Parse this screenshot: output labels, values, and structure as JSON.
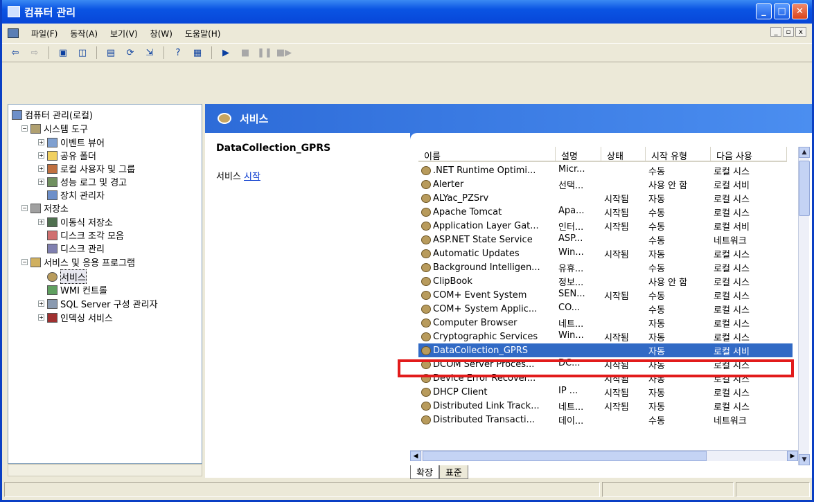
{
  "window": {
    "title": "컴퓨터 관리"
  },
  "menu": {
    "items": [
      "파일(F)",
      "동작(A)",
      "보기(V)",
      "창(W)",
      "도움말(H)"
    ]
  },
  "tree": {
    "root": "컴퓨터 관리(로컬)",
    "nodes": [
      "시스템 도구",
      "이벤트 뷰어",
      "공유 폴더",
      "로컬 사용자 및 그룹",
      "성능 로그 및 경고",
      "장치 관리자",
      "저장소",
      "이동식 저장소",
      "디스크 조각 모음",
      "디스크 관리",
      "서비스 및 응용 프로그램",
      "서비스",
      "WMI 컨트롤",
      "SQL Server 구성 관리자",
      "인덱싱 서비스"
    ]
  },
  "pane": {
    "title": "서비스",
    "selected_service": "DataCollection_GPRS",
    "action_prefix": "서비스",
    "action_link": "시작"
  },
  "list": {
    "headers": [
      "이름",
      "설명",
      "상태",
      "시작 유형",
      "다음 사용"
    ],
    "rows": [
      [
        ".NET Runtime Optimi...",
        "Micr...",
        "",
        "수동",
        "로컬 시스"
      ],
      [
        "Alerter",
        "선택...",
        "",
        "사용 안 함",
        "로컬 서비"
      ],
      [
        "ALYac_PZSrv",
        "",
        "시작됨",
        "자동",
        "로컬 시스"
      ],
      [
        "Apache Tomcat",
        "Apa...",
        "시작됨",
        "수동",
        "로컬 시스"
      ],
      [
        "Application Layer Gat...",
        "인터...",
        "시작됨",
        "수동",
        "로컬 서비"
      ],
      [
        "ASP.NET State Service",
        "ASP...",
        "",
        "수동",
        "네트워크"
      ],
      [
        "Automatic Updates",
        "Win...",
        "시작됨",
        "자동",
        "로컬 시스"
      ],
      [
        "Background Intelligen...",
        "유휴...",
        "",
        "수동",
        "로컬 시스"
      ],
      [
        "ClipBook",
        "정보...",
        "",
        "사용 안 함",
        "로컬 시스"
      ],
      [
        "COM+ Event System",
        "SEN...",
        "시작됨",
        "수동",
        "로컬 시스"
      ],
      [
        "COM+ System Applic...",
        "CO...",
        "",
        "수동",
        "로컬 시스"
      ],
      [
        "Computer Browser",
        "네트...",
        "",
        "자동",
        "로컬 시스"
      ],
      [
        "Cryptographic Services",
        "Win...",
        "시작됨",
        "자동",
        "로컬 시스"
      ],
      [
        "DataCollection_GPRS",
        "",
        "",
        "자동",
        "로컬 서비"
      ],
      [
        "DCOM Server Proces...",
        "DC...",
        "시작됨",
        "자동",
        "로컬 시스"
      ],
      [
        "Device Error Recover...",
        "",
        "시작됨",
        "자동",
        "로컬 시스"
      ],
      [
        "DHCP Client",
        "IP ...",
        "시작됨",
        "자동",
        "로컬 시스"
      ],
      [
        "Distributed Link Track...",
        "네트...",
        "시작됨",
        "자동",
        "로컬 시스"
      ],
      [
        "Distributed Transacti...",
        "데이...",
        "",
        "수동",
        "네트워크"
      ]
    ],
    "selected_index": 13
  },
  "tabs": [
    "확장",
    "표준"
  ]
}
